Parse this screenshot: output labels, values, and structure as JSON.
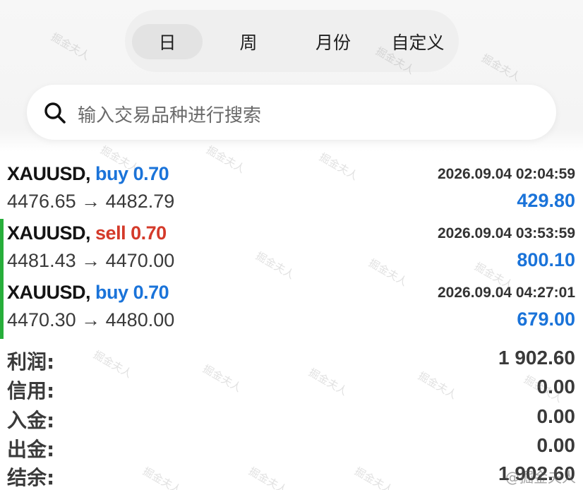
{
  "tabs": [
    {
      "label": "日"
    },
    {
      "label": "周"
    },
    {
      "label": "月份"
    },
    {
      "label": "自定义"
    }
  ],
  "search": {
    "placeholder": "输入交易品种进行搜索"
  },
  "trades": [
    {
      "symbol": "XAUUSD,",
      "side": "buy",
      "volume": "0.70",
      "time": "2026.09.04 02:04:59",
      "open_price": "4476.65",
      "close_price": "4482.79",
      "profit": "429.80"
    },
    {
      "symbol": "XAUUSD,",
      "side": "sell",
      "volume": "0.70",
      "time": "2026.09.04 03:53:59",
      "open_price": "4481.43",
      "close_price": "4470.00",
      "profit": "800.10"
    },
    {
      "symbol": "XAUUSD,",
      "side": "buy",
      "volume": "0.70",
      "time": "2026.09.04 04:27:01",
      "open_price": "4470.30",
      "close_price": "4480.00",
      "profit": "679.00"
    }
  ],
  "arrow": "→",
  "summary": [
    {
      "label": "利润:",
      "value": "1 902.60"
    },
    {
      "label": "信用:",
      "value": "0.00"
    },
    {
      "label": "入金:",
      "value": "0.00"
    },
    {
      "label": "出金:",
      "value": "0.00"
    },
    {
      "label": "结余:",
      "value": "1 902.60"
    }
  ],
  "watermark": {
    "text": "掘金夫人",
    "credit": "@掘金夫人"
  },
  "colors": {
    "buy": "#1a73d9",
    "sell": "#d43a2a",
    "profit": "#1a73d9",
    "bar": "#27ae3a"
  }
}
